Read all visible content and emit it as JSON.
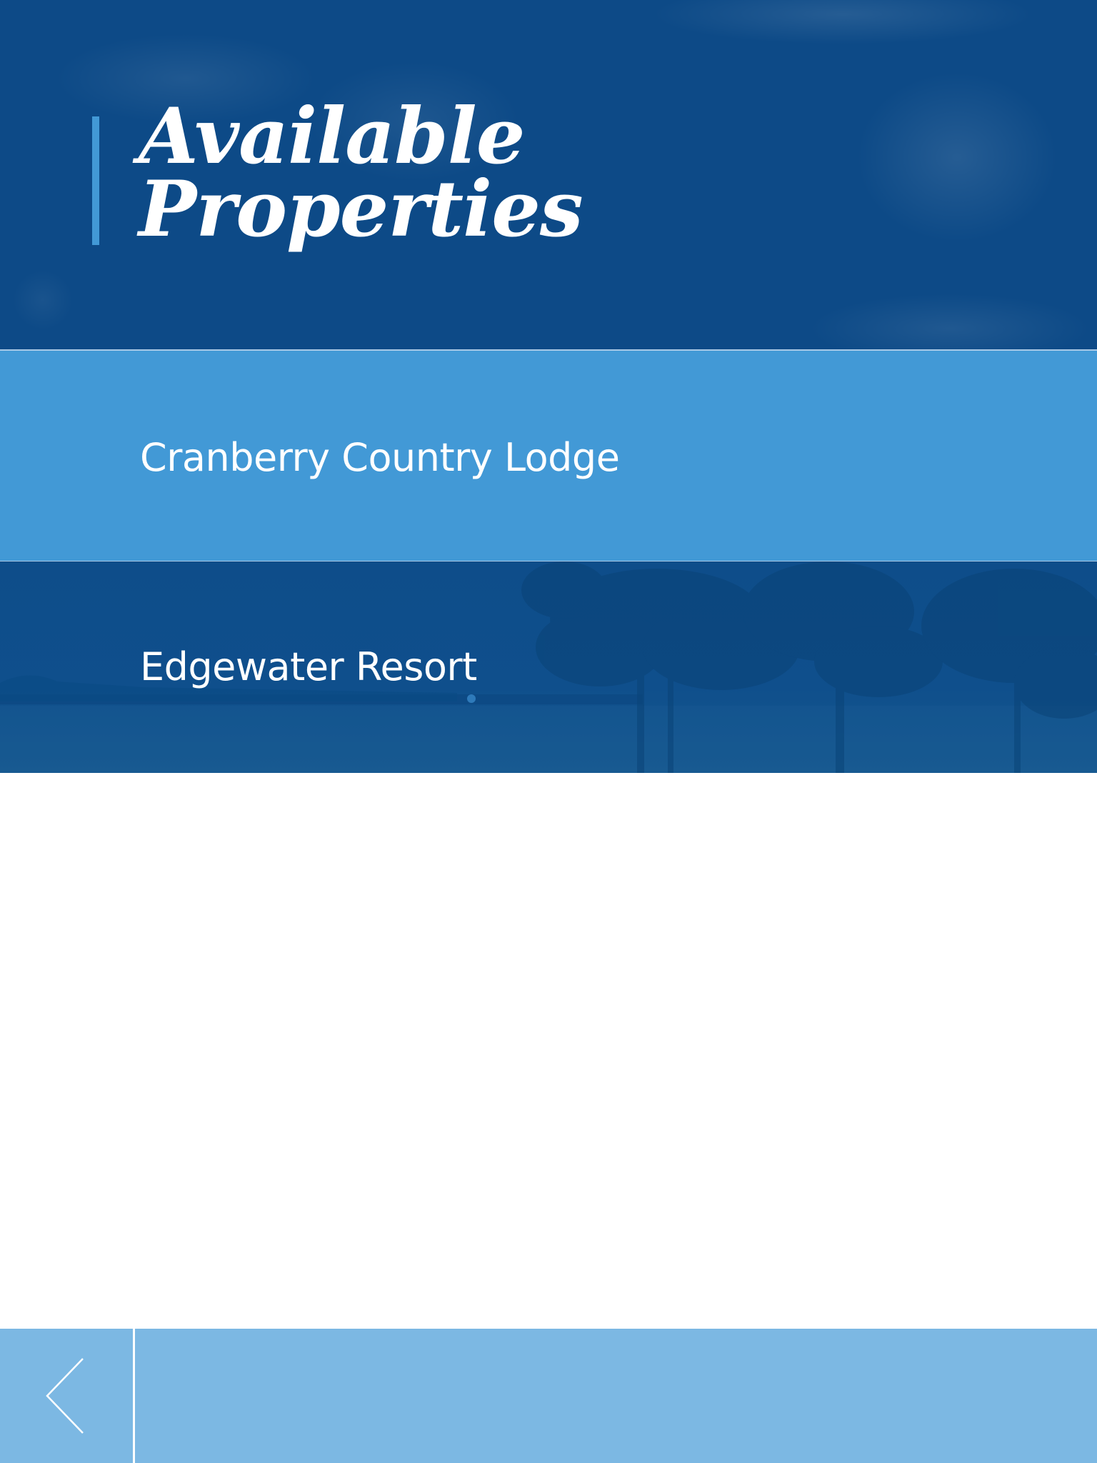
{
  "header": {
    "title_line1": "Available",
    "title_line2": "Properties"
  },
  "properties": [
    {
      "label": "Cranberry Country Lodge"
    },
    {
      "label": "Edgewater Resort"
    }
  ],
  "footer": {
    "back_icon": "chevron-left-icon"
  },
  "colors": {
    "header_bg": "#0d4a87",
    "accent": "#4299d6",
    "row_selected": "#4299d6",
    "row_dark": "#0e4d8a",
    "footer_bg": "#7cb8e3",
    "text": "#ffffff",
    "page_bg": "#ffffff"
  }
}
